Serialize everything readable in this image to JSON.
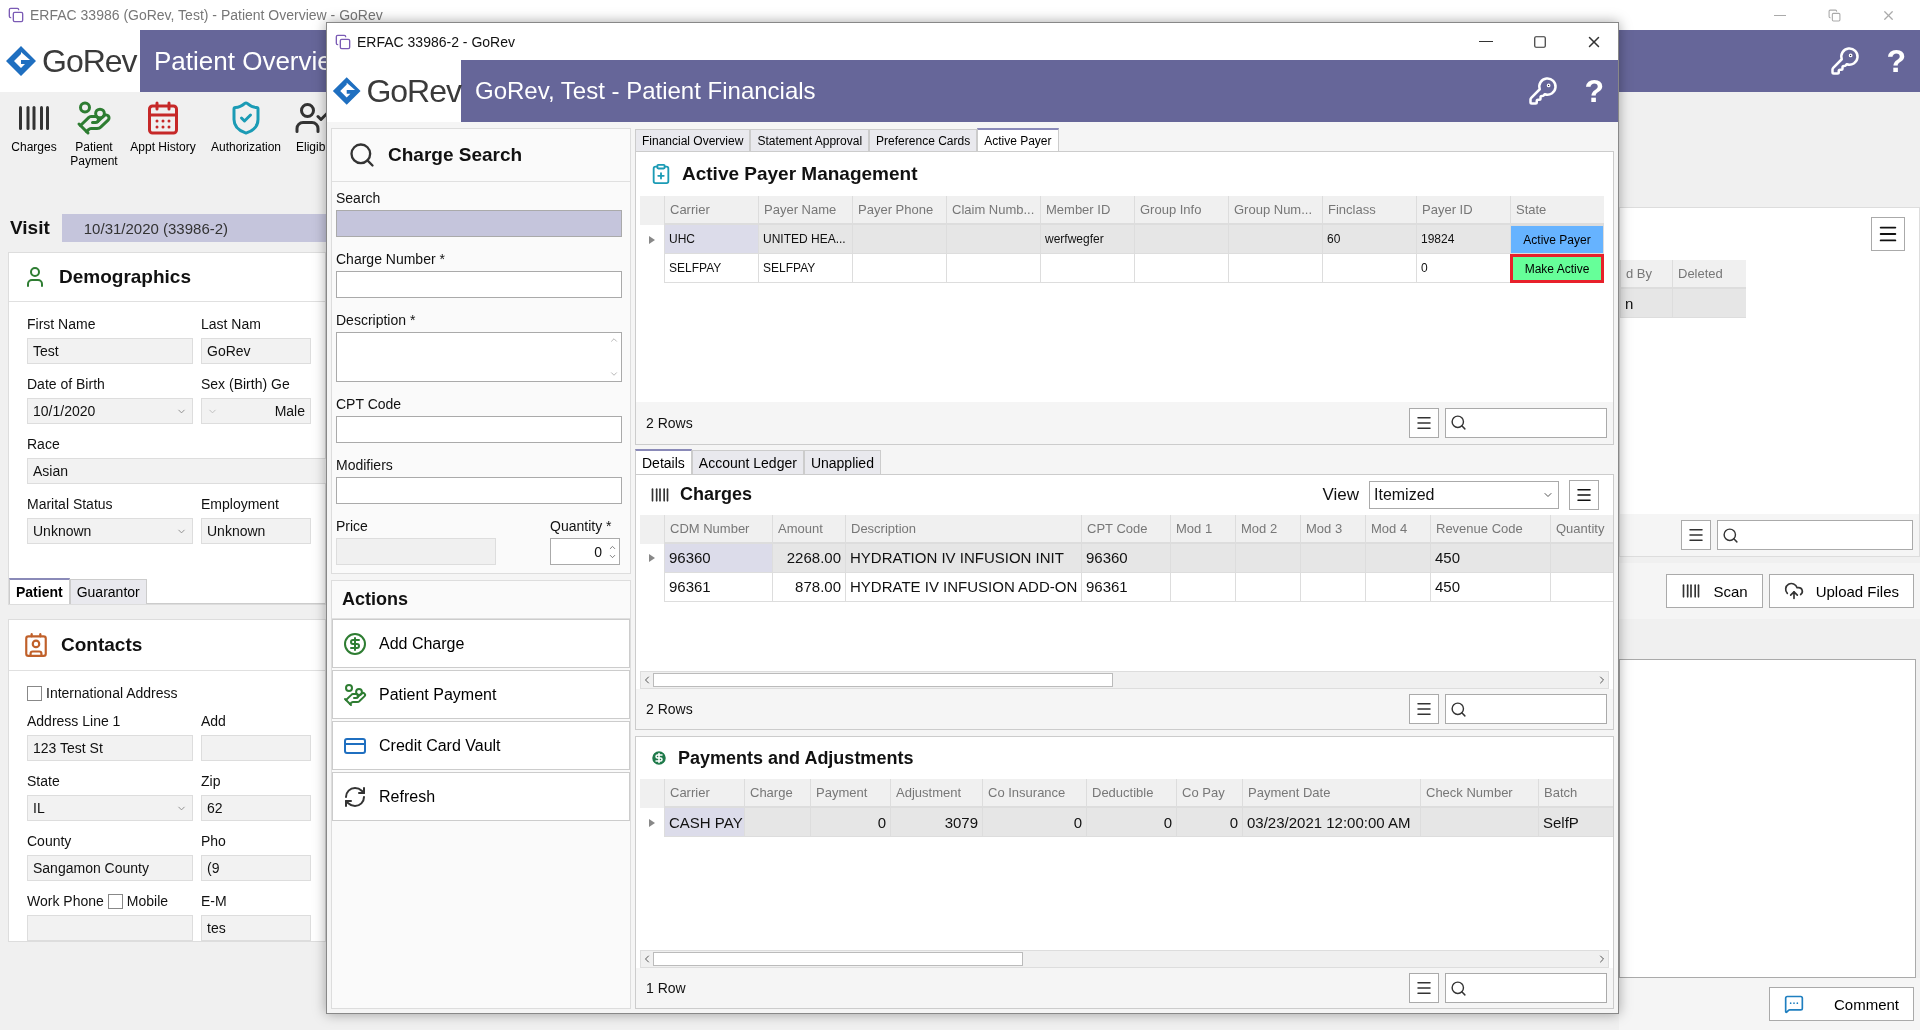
{
  "background_window": {
    "title": "ERFAC 33986 (GoRev, Test) - Patient Overview - GoRev",
    "logo": "GoRev",
    "header_title": "Patient Overvie",
    "help_glyph": "?",
    "toolbar": [
      {
        "label": "Charges"
      },
      {
        "label": "Patient Payment"
      },
      {
        "label": "Appt History"
      },
      {
        "label": "Authorization"
      },
      {
        "label": "Eligibi"
      }
    ],
    "visit": {
      "label": "Visit",
      "value": "10/31/2020 (33986-2)"
    },
    "demographics": {
      "title": "Demographics",
      "rows": [
        [
          {
            "label": "First Name",
            "value": "Test",
            "kind": "text"
          },
          {
            "label": "Last Nam",
            "value": "GoRev",
            "kind": "text"
          }
        ],
        [
          {
            "label": "Date of Birth",
            "value": "10/1/2020",
            "kind": "dropdown"
          },
          {
            "label": "Sex (Birth) Ge",
            "value": "Male",
            "kind": "picker"
          }
        ],
        [
          {
            "label": "Race",
            "value": "Asian",
            "kind": "wide"
          }
        ],
        [
          {
            "label": "Marital Status",
            "value": "Unknown",
            "kind": "dropdown"
          },
          {
            "label": "Employment",
            "value": "Unknown",
            "kind": "text"
          }
        ]
      ]
    },
    "tabs": [
      {
        "label": "Patient",
        "selected": true
      },
      {
        "label": "Guarantor",
        "selected": false
      }
    ],
    "contacts": {
      "title": "Contacts",
      "international": {
        "label": "International Address",
        "checked": false
      },
      "rows": [
        [
          {
            "label": "Address Line 1",
            "value": "123 Test St",
            "kind": "text"
          },
          {
            "label": "Add",
            "kind": "text"
          }
        ],
        [
          {
            "label": "State",
            "value": "IL",
            "kind": "dropdown"
          },
          {
            "label": "Zip",
            "value": "62",
            "kind": "text"
          }
        ],
        [
          {
            "label": "County",
            "value": "Sangamon County",
            "kind": "text"
          },
          {
            "label": "Pho",
            "value": "(9",
            "kind": "text"
          }
        ],
        [
          {
            "label": "Work Phone",
            "kind": "text",
            "checkbox": {
              "label": "Mobile",
              "checked": false
            }
          },
          {
            "label": "E-M",
            "value": "tes",
            "kind": "text"
          }
        ]
      ]
    },
    "right_panel": {
      "columns": [
        "d By",
        "Deleted"
      ],
      "rows": [
        [
          "n",
          null
        ]
      ],
      "buttons": [
        {
          "label": "Scan"
        },
        {
          "label": "Upload Files"
        }
      ],
      "comment": "Comment"
    }
  },
  "dialog": {
    "title": "ERFAC 33986-2 - GoRev",
    "logo": "GoRev",
    "header_title": "GoRev, Test - Patient Financials",
    "help_glyph": "?",
    "charge_search": {
      "title": "Charge Search",
      "fields": [
        {
          "label": "Search",
          "kind": "search"
        },
        {
          "label": "Charge Number *",
          "kind": "text"
        },
        {
          "label": "Description *",
          "kind": "textarea"
        },
        {
          "label": "CPT Code",
          "kind": "text"
        },
        {
          "label": "Modifiers",
          "kind": "text"
        }
      ],
      "price": {
        "label": "Price"
      },
      "quantity": {
        "label": "Quantity *",
        "value": "0"
      }
    },
    "actions": {
      "title": "Actions",
      "buttons": [
        {
          "label": "Add Charge"
        },
        {
          "label": "Patient Payment"
        },
        {
          "label": "Credit Card Vault"
        },
        {
          "label": "Refresh"
        }
      ]
    },
    "tabs": [
      {
        "label": "Financial Overview",
        "selected": false
      },
      {
        "label": "Statement Approval",
        "selected": false
      },
      {
        "label": "Preference Cards",
        "selected": false
      },
      {
        "label": "Active Payer",
        "selected": true
      }
    ],
    "active_payer": {
      "title": "Active Payer Management",
      "footer": "2 Rows",
      "columns": [
        {
          "label": "Carrier"
        },
        {
          "label": "Payer Name"
        },
        {
          "label": "Payer Phone"
        },
        {
          "label": "Claim Numb..."
        },
        {
          "label": "Member ID"
        },
        {
          "label": "Group Info"
        },
        {
          "label": "Group Num..."
        },
        {
          "label": "Finclass"
        },
        {
          "label": "Payer ID"
        },
        {
          "label": "State"
        }
      ],
      "rows": [
        {
          "selected": true,
          "cells": [
            "UHC",
            "UNITED HEA...",
            null,
            null,
            "werfwegfer",
            null,
            null,
            "60",
            "19824"
          ],
          "state": {
            "kind": "active",
            "label": "Active Payer",
            "outlined": false
          }
        },
        {
          "selected": false,
          "cells": [
            "SELFPAY",
            "SELFPAY",
            null,
            null,
            null,
            null,
            null,
            null,
            "0"
          ],
          "state": {
            "kind": "make_active",
            "label": "Make Active",
            "outlined": true
          }
        }
      ]
    },
    "detail_tabs": [
      {
        "label": "Details",
        "selected": true
      },
      {
        "label": "Account Ledger",
        "selected": false
      },
      {
        "label": "Unapplied",
        "selected": false
      }
    ],
    "charges": {
      "title": "Charges",
      "view_label": "View",
      "view": "Itemized",
      "footer": "2 Rows",
      "columns": [
        {
          "label": "CDM Number"
        },
        {
          "label": "Amount",
          "numeric": true
        },
        {
          "label": "Description"
        },
        {
          "label": "CPT Code"
        },
        {
          "label": "Mod 1"
        },
        {
          "label": "Mod 2"
        },
        {
          "label": "Mod 3"
        },
        {
          "label": "Mod 4"
        },
        {
          "label": "Revenue Code"
        },
        {
          "label": "Quantity"
        }
      ],
      "rows": [
        {
          "selected": true,
          "cells": [
            "96360",
            "2268.00",
            "HYDRATION IV INFUSION INIT",
            "96360",
            null,
            null,
            null,
            null,
            "450",
            null
          ]
        },
        {
          "selected": false,
          "cells": [
            "96361",
            "878.00",
            "HYDRATE IV INFUSION ADD-ON",
            "96361",
            null,
            null,
            null,
            null,
            "450",
            null
          ]
        }
      ]
    },
    "payments": {
      "title": "Payments and Adjustments",
      "footer": "1 Row",
      "columns": [
        {
          "label": "Carrier"
        },
        {
          "label": "Charge"
        },
        {
          "label": "Payment",
          "numeric": true
        },
        {
          "label": "Adjustment",
          "numeric": true
        },
        {
          "label": "Co Insurance",
          "numeric": true
        },
        {
          "label": "Deductible",
          "numeric": true
        },
        {
          "label": "Co Pay",
          "numeric": true
        },
        {
          "label": "Payment Date"
        },
        {
          "label": "Check Number"
        },
        {
          "label": "Batch"
        }
      ],
      "rows": [
        {
          "selected": true,
          "cells": [
            "CASH PAY",
            null,
            "0",
            "3079",
            "0",
            "0",
            "0",
            "03/23/2021 12:00:00 AM",
            null,
            "SelfP"
          ]
        }
      ]
    }
  }
}
